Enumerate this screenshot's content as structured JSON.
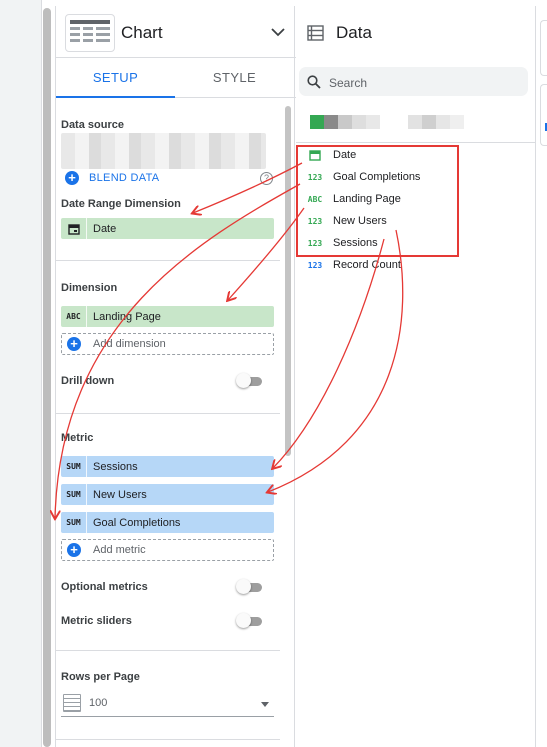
{
  "chart_panel": {
    "title": "Chart",
    "tabs": [
      {
        "label": "SETUP",
        "active": true
      },
      {
        "label": "STYLE",
        "active": false
      }
    ],
    "data_source": {
      "label": "Data source",
      "blend_label": "BLEND DATA"
    },
    "date_range": {
      "label": "Date Range Dimension",
      "chip": {
        "tag": "calendar-icon",
        "label": "Date"
      }
    },
    "dimension": {
      "label": "Dimension",
      "chip": {
        "tag": "ABC",
        "label": "Landing Page"
      },
      "add_label": "Add dimension",
      "drill_down_label": "Drill down"
    },
    "metric": {
      "label": "Metric",
      "chips": [
        {
          "tag": "SUM",
          "label": "Sessions"
        },
        {
          "tag": "SUM",
          "label": "New Users"
        },
        {
          "tag": "SUM",
          "label": "Goal Completions"
        }
      ],
      "add_label": "Add metric",
      "optional_label": "Optional metrics",
      "sliders_label": "Metric sliders"
    },
    "rows": {
      "label": "Rows per Page",
      "value": "100"
    }
  },
  "data_panel": {
    "title": "Data",
    "search_placeholder": "Search",
    "fields": [
      {
        "type": "calendar-icon",
        "label": "Date"
      },
      {
        "type": "123",
        "label": "Goal Completions"
      },
      {
        "type": "ABC",
        "label": "Landing Page"
      },
      {
        "type": "123",
        "label": "New Users"
      },
      {
        "type": "123",
        "label": "Sessions"
      },
      {
        "type": "123",
        "label": "Record Count"
      }
    ]
  },
  "colors": {
    "accent": "#1a73e8",
    "dimension_chip": "#c8e6c9",
    "metric_chip": "#b6d7f7",
    "annotation": "#e53935",
    "field_type_dim": "#34a853",
    "field_type_metric": "#1a73e8"
  }
}
